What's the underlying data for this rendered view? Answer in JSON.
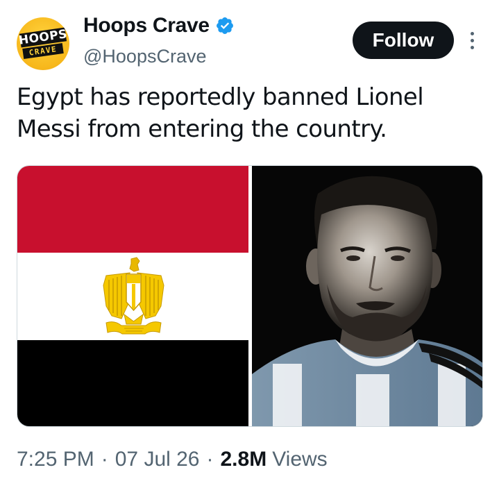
{
  "account": {
    "display_name": "Hoops Crave",
    "handle": "@HoopsCrave",
    "avatar_text_top": "HOOPS",
    "avatar_text_bottom": "CRAVE",
    "verified_icon": "verified-badge-icon",
    "verified_color": "#1d9bf0"
  },
  "actions": {
    "follow_label": "Follow",
    "more_icon": "more-vertical-icon"
  },
  "tweet": {
    "text": "Egypt has reportedly banned Lionel Messi from entering the country.",
    "media": [
      {
        "kind": "flag",
        "name": "egypt-flag-image",
        "colors": [
          "#c8102e",
          "#ffffff",
          "#000000"
        ]
      },
      {
        "kind": "photo",
        "name": "messi-portrait-image"
      }
    ]
  },
  "meta": {
    "time": "7:25 PM",
    "separator": "·",
    "date": "07 Jul 26",
    "views_count": "2.8M",
    "views_label": "Views"
  }
}
